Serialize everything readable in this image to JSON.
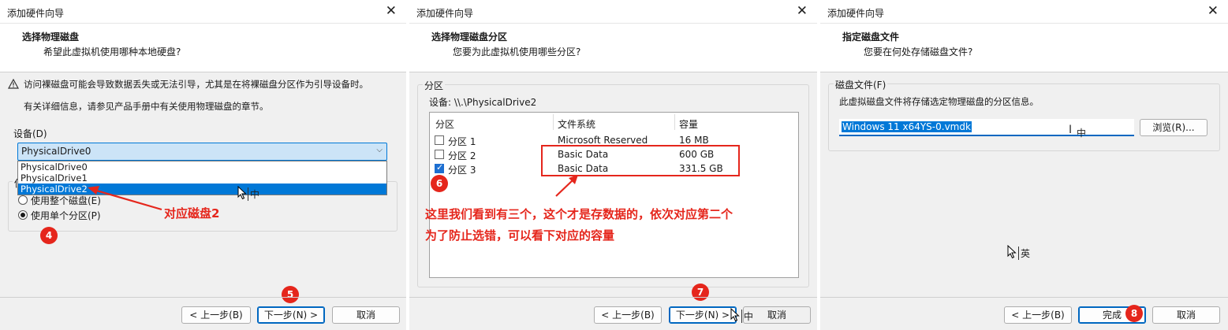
{
  "window1": {
    "title": "添加硬件向导",
    "header_title": "选择物理磁盘",
    "header_subtitle": "希望此虚拟机使用哪种本地硬盘?",
    "warning_text": "访问裸磁盘可能会导致数据丢失或无法引导，尤其是在将裸磁盘分区作为引导设备时。",
    "info_text": "有关详细信息，请参见产品手册中有关使用物理磁盘的章节。",
    "device_label": "设备(D)",
    "device_selected": "PhysicalDrive0",
    "device_options": [
      "PhysicalDrive0",
      "PhysicalDrive1",
      "PhysicalDrive2"
    ],
    "usage_group_label": "使",
    "radio_whole": "使用整个磁盘(E)",
    "radio_single": "使用单个分区(P)",
    "ime_indicator": "中",
    "annotation": "对应磁盘2",
    "badge_4": "4",
    "badge_5": "5",
    "btn_back": "< 上一步(B)",
    "btn_next": "下一步(N) >",
    "btn_cancel": "取消"
  },
  "window2": {
    "title": "添加硬件向导",
    "header_title": "选择物理磁盘分区",
    "header_subtitle": "您要为此虚拟机使用哪些分区?",
    "group_label": "分区",
    "device_line": "设备: \\\\.\\PhysicalDrive2",
    "columns": [
      "分区",
      "文件系统",
      "容量"
    ],
    "rows": [
      {
        "partition": "分区 1",
        "fs": "Microsoft Reserved",
        "size": "16 MB",
        "checked": false
      },
      {
        "partition": "分区 2",
        "fs": "Basic Data",
        "size": "600 GB",
        "checked": false
      },
      {
        "partition": "分区 3",
        "fs": "Basic Data",
        "size": "331.5 GB",
        "checked": true
      }
    ],
    "annotation_line1": "这里我们看到有三个，这个才是存数据的，依次对应第二个",
    "annotation_line2": "为了防止选错，可以看下对应的容量",
    "badge_6": "6",
    "badge_7": "7",
    "ime_indicator": "中",
    "btn_back": "< 上一步(B)",
    "btn_next": "下一步(N) >",
    "btn_cancel": "取消"
  },
  "window3": {
    "title": "添加硬件向导",
    "header_title": "指定磁盘文件",
    "header_subtitle": "您要在何处存储磁盘文件?",
    "group_label": "磁盘文件(F)",
    "description": "此虚拟磁盘文件将存储选定物理磁盘的分区信息。",
    "file_value": "Windows 11 x64YS-0.vmdk",
    "ime_indicator": "中",
    "ime_indicator2": "英",
    "btn_browse": "浏览(R)...",
    "badge_8": "8",
    "btn_back": "< 上一步(B)",
    "btn_finish": "完成",
    "btn_cancel": "取消"
  },
  "colors": {
    "annotation_red": "#e5261c",
    "selection_blue": "#0078d7",
    "button_border_primary": "#0067c0",
    "window_bg": "#f0f0f0"
  }
}
